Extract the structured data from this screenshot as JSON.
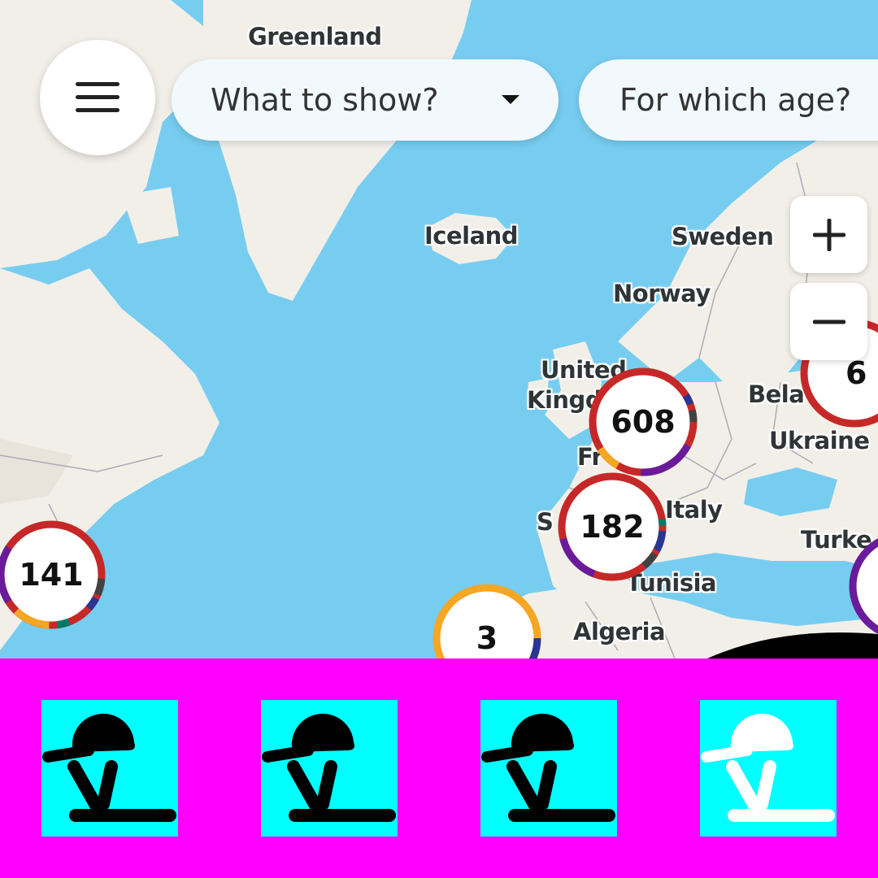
{
  "filters": {
    "show_placeholder": "What to show?",
    "age_placeholder": "For which age?"
  },
  "map": {
    "labels": {
      "greenland": "Greenland",
      "iceland": "Iceland",
      "sweden": "Sweden",
      "norway": "Norway",
      "united": "United",
      "kingdom": "Kingd",
      "belarus": "Bela",
      "ukraine": "Ukraine",
      "france": "Fr",
      "spain": "S",
      "italy": "Italy",
      "turkey": "Turke",
      "tunisia": "Tunisia",
      "algeria": "Algeria"
    },
    "clusters": [
      {
        "id": "west-europe",
        "count": "608"
      },
      {
        "id": "south-europe",
        "count": "182"
      },
      {
        "id": "north-america",
        "count": "141"
      },
      {
        "id": "north-africa",
        "count": "3"
      },
      {
        "id": "east-europe",
        "count": "6"
      }
    ]
  },
  "zoom": {
    "in_label": "+",
    "out_label": "−"
  },
  "colors": {
    "water": "#77cdf0",
    "land": "#f2efe9",
    "cluster_red": "#c62828",
    "cluster_purple": "#6a1b9a",
    "cluster_orange": "#f5a623",
    "cluster_navy": "#283593",
    "cluster_teal": "#00796b",
    "cluster_grey": "#424242",
    "bar_background": "#ff00ff",
    "tile_background": "#00ffff"
  },
  "bottom_bar": {
    "icons": [
      "umbrella-icon",
      "umbrella-icon",
      "umbrella-icon",
      "umbrella-icon-white"
    ]
  }
}
